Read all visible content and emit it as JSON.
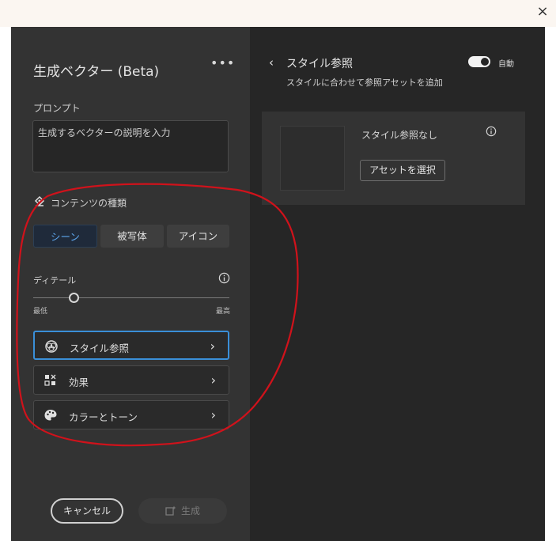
{
  "window": {
    "close_glyph": "×"
  },
  "panel": {
    "title": "生成ベクター (Beta)",
    "more_glyph": "•••",
    "prompt": {
      "label": "プロンプト",
      "placeholder": "生成するベクターの説明を入力"
    },
    "content_type": {
      "label": "コンテンツの種類",
      "options": [
        "シーン",
        "被写体",
        "アイコン"
      ],
      "selected": "シーン"
    },
    "detail": {
      "label": "ディテール",
      "min_label": "最低",
      "max_label": "最高",
      "value_fraction": 0.22
    },
    "rows": [
      {
        "label": "スタイル参照",
        "icon": "style-reference-icon",
        "active": true
      },
      {
        "label": "効果",
        "icon": "effects-icon",
        "active": false
      },
      {
        "label": "カラーとトーン",
        "icon": "palette-icon",
        "active": false
      }
    ],
    "footer": {
      "cancel": "キャンセル",
      "generate": "生成"
    }
  },
  "style_ref_panel": {
    "back_glyph": "‹",
    "title": "スタイル参照",
    "subtitle": "スタイルに合わせて参照アセットを追加",
    "auto_label": "自動",
    "auto_on": true,
    "card": {
      "empty_text": "スタイル参照なし",
      "select_button": "アセットを選択"
    }
  },
  "colors": {
    "panel_left": "#333333",
    "panel_right": "#262626",
    "accent_blue": "#3a8fd8",
    "selected_segment_bg": "#1f2a3a",
    "annotation_red": "#d0121b"
  }
}
